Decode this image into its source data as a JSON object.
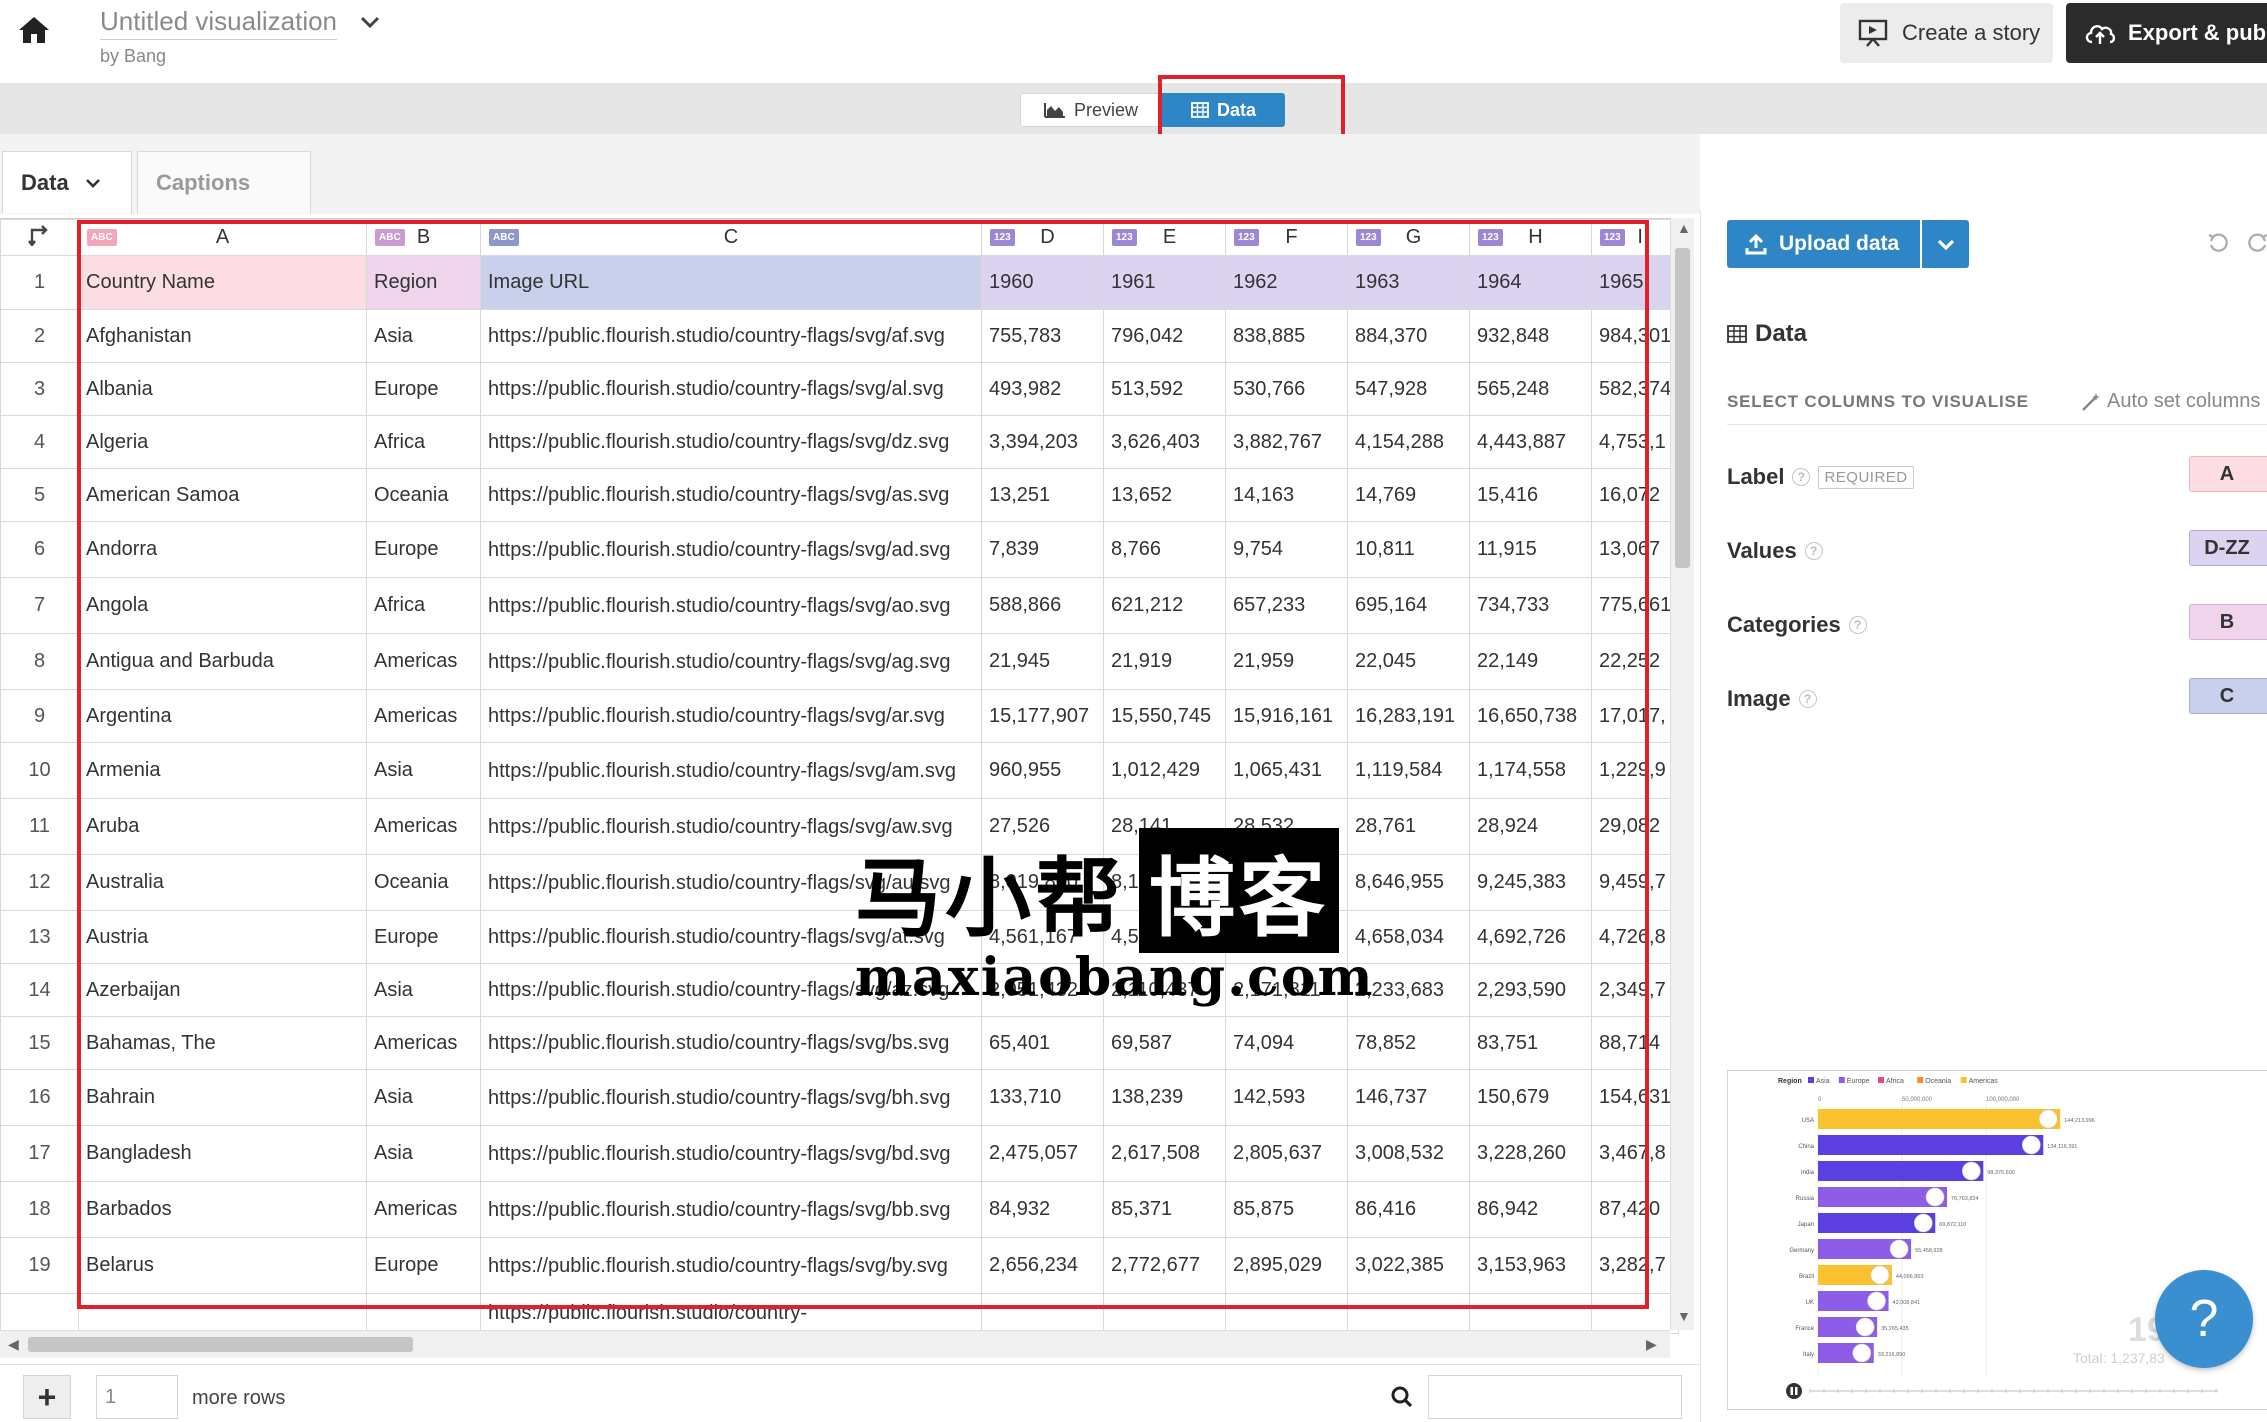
{
  "header": {
    "title": "Untitled visualization",
    "author": "by Bang",
    "create_story_label": "Create a story",
    "export_label": "Export & publi"
  },
  "modes": {
    "preview_label": "Preview",
    "data_label": "Data"
  },
  "sheet_tabs": {
    "data_label": "Data",
    "captions_label": "Captions"
  },
  "grid": {
    "column_letters": [
      "A",
      "B",
      "C",
      "D",
      "E",
      "F",
      "G",
      "H",
      "I"
    ],
    "column_type_badges": [
      "ABC",
      "ABC",
      "ABC",
      "123",
      "123",
      "123",
      "123",
      "123",
      "123"
    ],
    "header_row": [
      "Country Name",
      "Region",
      "Image URL",
      "1960",
      "1961",
      "1962",
      "1963",
      "1964",
      "1965"
    ],
    "rows": [
      {
        "n": "2",
        "cells": [
          "Afghanistan",
          "Asia",
          "https://public.flourish.studio/country-flags/svg/af.svg",
          "755,783",
          "796,042",
          "838,885",
          "884,370",
          "932,848",
          "984,301"
        ]
      },
      {
        "n": "3",
        "cells": [
          "Albania",
          "Europe",
          "https://public.flourish.studio/country-flags/svg/al.svg",
          "493,982",
          "513,592",
          "530,766",
          "547,928",
          "565,248",
          "582,374"
        ]
      },
      {
        "n": "4",
        "cells": [
          "Algeria",
          "Africa",
          "https://public.flourish.studio/country-flags/svg/dz.svg",
          "3,394,203",
          "3,626,403",
          "3,882,767",
          "4,154,288",
          "4,443,887",
          "4,753,1"
        ]
      },
      {
        "n": "5",
        "cells": [
          "American Samoa",
          "Oceania",
          "https://public.flourish.studio/country-flags/svg/as.svg",
          "13,251",
          "13,652",
          "14,163",
          "14,769",
          "15,416",
          "16,072"
        ]
      },
      {
        "n": "6",
        "cells": [
          "Andorra",
          "Europe",
          "https://public.flourish.studio/country-flags/svg/ad.svg",
          "7,839",
          "8,766",
          "9,754",
          "10,811",
          "11,915",
          "13,067"
        ]
      },
      {
        "n": "7",
        "cells": [
          "Angola",
          "Africa",
          "https://public.flourish.studio/country-flags/svg/ao.svg",
          "588,866",
          "621,212",
          "657,233",
          "695,164",
          "734,733",
          "775,661"
        ]
      },
      {
        "n": "8",
        "cells": [
          "Antigua and Barbuda",
          "Americas",
          "https://public.flourish.studio/country-flags/svg/ag.svg",
          "21,945",
          "21,919",
          "21,959",
          "22,045",
          "22,149",
          "22,252"
        ]
      },
      {
        "n": "9",
        "cells": [
          "Argentina",
          "Americas",
          "https://public.flourish.studio/country-flags/svg/ar.svg",
          "15,177,907",
          "15,550,745",
          "15,916,161",
          "16,283,191",
          "16,650,738",
          "17,017,"
        ]
      },
      {
        "n": "10",
        "cells": [
          "Armenia",
          "Asia",
          "https://public.flourish.studio/country-flags/svg/am.svg",
          "960,955",
          "1,012,429",
          "1,065,431",
          "1,119,584",
          "1,174,558",
          "1,229,9"
        ]
      },
      {
        "n": "11",
        "cells": [
          "Aruba",
          "Americas",
          "https://public.flourish.studio/country-flags/svg/aw.svg",
          "27,526",
          "28,141",
          "28,532",
          "28,761",
          "28,924",
          "29,082"
        ]
      },
      {
        "n": "12",
        "cells": [
          "Australia",
          "Oceania",
          "https://public.flourish.studio/country-flags/svg/au.svg",
          "8,019,800",
          "8,189,800",
          "8,422,800",
          "8,646,955",
          "9,245,383",
          "9,459,7"
        ]
      },
      {
        "n": "13",
        "cells": [
          "Austria",
          "Europe",
          "https://public.flourish.studio/country-flags/svg/at.svg",
          "4,561,167",
          "4,592,914",
          "4,624,644",
          "4,658,034",
          "4,692,726",
          "4,726,8"
        ]
      },
      {
        "n": "14",
        "cells": [
          "Azerbaijan",
          "Asia",
          "https://public.flourish.studio/country-flags/svg/az.svg",
          "2,051,432",
          "2,110,437",
          "2,171,811",
          "2,233,683",
          "2,293,590",
          "2,349,7"
        ]
      },
      {
        "n": "15",
        "cells": [
          "Bahamas, The",
          "Americas",
          "https://public.flourish.studio/country-flags/svg/bs.svg",
          "65,401",
          "69,587",
          "74,094",
          "78,852",
          "83,751",
          "88,714"
        ]
      },
      {
        "n": "16",
        "cells": [
          "Bahrain",
          "Asia",
          "https://public.flourish.studio/country-flags/svg/bh.svg",
          "133,710",
          "138,239",
          "142,593",
          "146,737",
          "150,679",
          "154,631"
        ]
      },
      {
        "n": "17",
        "cells": [
          "Bangladesh",
          "Asia",
          "https://public.flourish.studio/country-flags/svg/bd.svg",
          "2,475,057",
          "2,617,508",
          "2,805,637",
          "3,008,532",
          "3,228,260",
          "3,467,8"
        ]
      },
      {
        "n": "18",
        "cells": [
          "Barbados",
          "Americas",
          "https://public.flourish.studio/country-flags/svg/bb.svg",
          "84,932",
          "85,371",
          "85,875",
          "86,416",
          "86,942",
          "87,420"
        ]
      },
      {
        "n": "19",
        "cells": [
          "Belarus",
          "Europe",
          "https://public.flourish.studio/country-flags/svg/by.svg",
          "2,656,234",
          "2,772,677",
          "2,895,029",
          "3,022,385",
          "3,153,963",
          "3,282,7"
        ]
      },
      {
        "n": "",
        "cells": [
          "",
          "",
          "https://public.flourish.studio/country-",
          "",
          "",
          "",
          "",
          "",
          ""
        ]
      }
    ],
    "wrapped_rows": [
      "6",
      "7",
      "8",
      "10",
      "11",
      "12",
      "16",
      "17",
      "18",
      "19"
    ]
  },
  "bottom": {
    "rows_value": "1",
    "more_rows_label": "more rows"
  },
  "panel": {
    "upload_label": "Upload data",
    "heading": "Data",
    "select_columns_label": "SELECT COLUMNS TO VISUALISE",
    "auto_set_label": "Auto set columns",
    "bindings": [
      {
        "label": "Label",
        "required": "REQUIRED",
        "value": "A"
      },
      {
        "label": "Values",
        "required": "",
        "value": "D-ZZ"
      },
      {
        "label": "Categories",
        "required": "",
        "value": "B"
      },
      {
        "label": "Image",
        "required": "",
        "value": "C"
      }
    ]
  },
  "preview": {
    "legend_title": "Region",
    "legend": [
      {
        "name": "Asia",
        "color": "#5b3fe0"
      },
      {
        "name": "Europe",
        "color": "#8e5de8"
      },
      {
        "name": "Africa",
        "color": "#e24a8d"
      },
      {
        "name": "Oceania",
        "color": "#f28e2b"
      },
      {
        "name": "Americas",
        "color": "#f9c22e"
      }
    ],
    "axis_ticks": [
      "0",
      "50,000,000",
      "100,000,000"
    ],
    "bars": [
      {
        "name": "USA",
        "value": 144.2,
        "label": "144,213,996",
        "color": "#f9c22e"
      },
      {
        "name": "China",
        "value": 134.1,
        "label": "134,116,391",
        "color": "#5b3fe0"
      },
      {
        "name": "India",
        "value": 98.4,
        "label": "98,376,600",
        "color": "#5b3fe0"
      },
      {
        "name": "Russia",
        "value": 76.8,
        "label": "76,763,834",
        "color": "#8e5de8"
      },
      {
        "name": "Japan",
        "value": 69.8,
        "label": "69,872,110",
        "color": "#5b3fe0"
      },
      {
        "name": "Germany",
        "value": 55.4,
        "label": "55,458,928",
        "color": "#8e5de8"
      },
      {
        "name": "Brazil",
        "value": 44.0,
        "label": "44,066,863",
        "color": "#f9c22e"
      },
      {
        "name": "UK",
        "value": 42.0,
        "label": "42,008,841",
        "color": "#8e5de8"
      },
      {
        "name": "France",
        "value": 35.2,
        "label": "35,265,435",
        "color": "#8e5de8"
      },
      {
        "name": "Italy",
        "value": 33.2,
        "label": "33,216,890",
        "color": "#8e5de8"
      }
    ],
    "year_partial": "19",
    "total_partial": "Total: 1,237,83"
  },
  "watermark": {
    "line1_a": "马小帮",
    "line1_b": "博客",
    "line2": "maxiaobang.com"
  },
  "colors": {
    "accent_blue": "#2f86c7",
    "highlight_red": "#e0202a"
  }
}
